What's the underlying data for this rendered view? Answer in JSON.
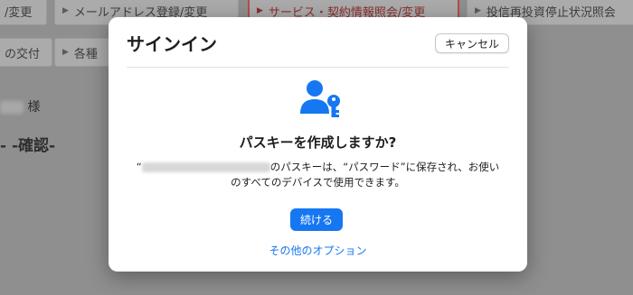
{
  "background": {
    "nav_row1": [
      {
        "label": "/変更",
        "active": false,
        "arrow": false
      },
      {
        "label": "メールアドレス登録/変更",
        "active": false,
        "arrow": true
      },
      {
        "label": "サービス・契約情報照会/変更",
        "active": true,
        "arrow": true
      },
      {
        "label": "投信再投資停止状況照会",
        "active": false,
        "arrow": true
      }
    ],
    "nav_row2": [
      {
        "label": "の交付",
        "arrow": false
      },
      {
        "label": "各種",
        "arrow": true
      }
    ],
    "honorific": "様",
    "confirm_label": "-確認-",
    "dash_label": "-"
  },
  "dialog": {
    "title": "サインイン",
    "cancel_label": "キャンセル",
    "heading": "パスキーを作成しますか?",
    "body_prefix": "“",
    "body_main": "のパスキーは、“パスワード”に保存され、お使いのすべてのデバイスで使用できます。",
    "continue_label": "続ける",
    "other_options_label": "その他のオプション",
    "accent_color": "#1677f2",
    "icon": "person-key-icon"
  }
}
